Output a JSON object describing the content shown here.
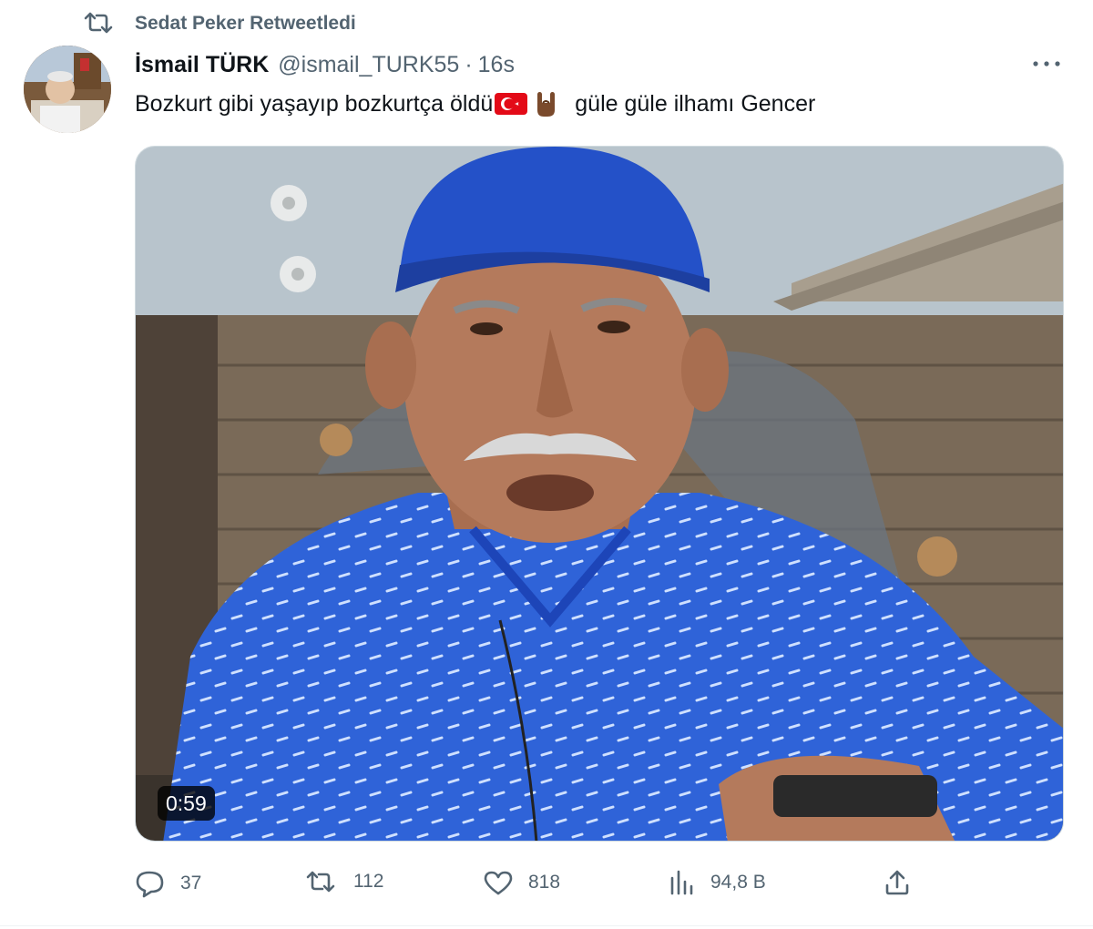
{
  "retweet": {
    "icon": "retweet-icon",
    "label": "Sedat Peker Retweetledi"
  },
  "author": {
    "display_name": "İsmail TÜRK",
    "handle": "@ismail_TURK55",
    "separator": "·",
    "time": "16s",
    "avatar_icon": "avatar"
  },
  "tweet": {
    "text_part1": "Bozkurt gibi yaşayıp bozkurtça öldü",
    "flag_icon": "turkey-flag-emoji",
    "hand_icon": "wolf-salute-hand-emoji",
    "text_part2": "güle güle ilhamı Gencer"
  },
  "media": {
    "type": "video",
    "duration": "0:59"
  },
  "actions": {
    "reply": {
      "icon": "reply-icon",
      "count": "37"
    },
    "retweet": {
      "icon": "retweet-icon",
      "count": "112"
    },
    "like": {
      "icon": "heart-icon",
      "count": "818"
    },
    "views": {
      "icon": "views-icon",
      "count": "94,8 B"
    },
    "share": {
      "icon": "share-icon"
    }
  },
  "more": {
    "icon": "more-icon"
  },
  "colors": {
    "secondary_text": "#536471",
    "primary_text": "#0f1419",
    "border": "#cfd9de"
  }
}
